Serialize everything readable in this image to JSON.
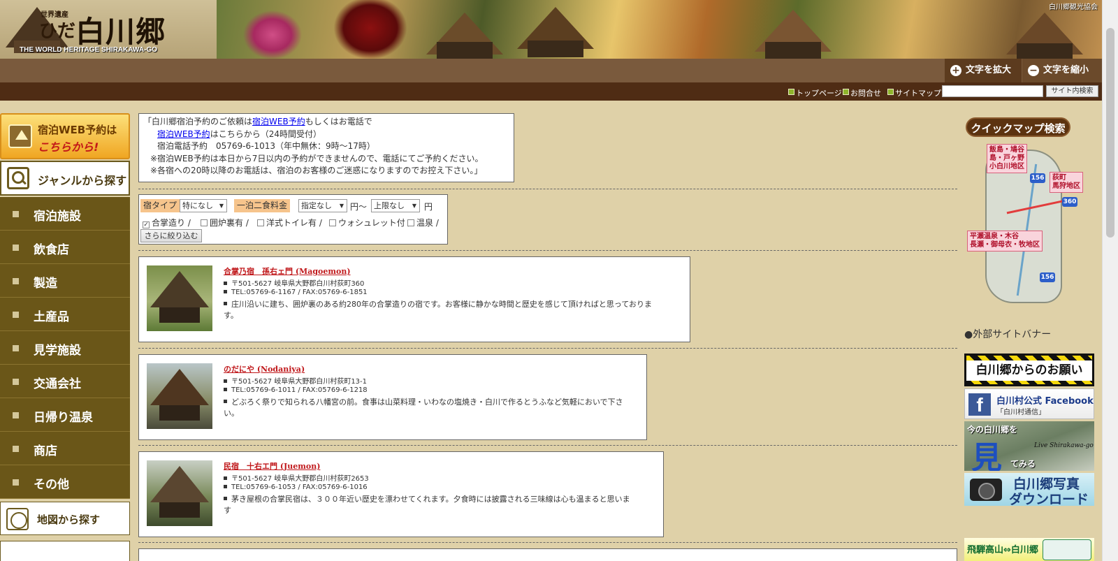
{
  "header": {
    "logo": {
      "heritage_label": "世界遺産",
      "hida_label": "ひだ",
      "name": "白川郷",
      "subtitle": "THE WORLD HERITAGE SHIRAKAWA-GO"
    },
    "association": "白川郷観光協会"
  },
  "font_controls": {
    "enlarge_label": "文字を拡大",
    "shrink_label": "文字を縮小"
  },
  "utility_nav": {
    "links": [
      "トップページ",
      "お問合せ",
      "サイトマップ"
    ],
    "search_placeholder": "",
    "search_button": "サイト内検索"
  },
  "sidebar": {
    "web_reserve": {
      "line1": "宿泊WEB予約は",
      "line2": "こちらから!"
    },
    "genre_heading": "ジャンルから探す",
    "genres": [
      "宿泊施設",
      "飲食店",
      "製造",
      "土産品",
      "見学施設",
      "交通会社",
      "日帰り温泉",
      "商店",
      "その他"
    ],
    "map_heading": "地図から探す"
  },
  "notice": {
    "line1_prefix": "「白川郷宿泊予約のご依頼は",
    "line1_link": "宿泊WEB予約",
    "line1_suffix": "もしくはお電話で",
    "line2_link": "宿泊WEB予約",
    "line2_suffix": "はこちらから（24時間受付）",
    "line3": "宿泊電話予約　05769-6-1013（年中無休：9時〜17時）",
    "line4": "※宿泊WEB予約は本日から7日以内の予約ができませんので、電話にてご予約ください。",
    "line5": "※各宿への20時以降のお電話は、宿泊のお客様のご迷惑になりますのでお控え下さい。」"
  },
  "filter": {
    "type_label": "宿タイプ",
    "type_value": "特になし",
    "price_label": "一泊二食料金",
    "price_min_value": "指定なし",
    "yen_from": "円〜",
    "price_max_value": "上限なし",
    "yen": "円",
    "checkboxes": [
      {
        "label": "合掌造り /",
        "checked": true
      },
      {
        "label": "囲炉裏有 /",
        "checked": false
      },
      {
        "label": "洋式トイレ有 /",
        "checked": false
      },
      {
        "label": "ウォシュレット付 /",
        "checked": false
      },
      {
        "label": "温泉 /",
        "checked": false
      }
    ],
    "submit_label": "さらに絞り込む"
  },
  "listings": [
    {
      "name": "合掌乃宿　孫右ェ門 (Magoemon)",
      "address": "〒501-5627 岐阜県大野郡白川村荻町360",
      "tel": "TEL:05769-6-1167 / FAX:05769-6-1851",
      "desc_line1": "庄川沿いに建ち、囲炉裏のある約280年の合掌造りの宿です。お客様に静かな時間と歴史を感じて頂ければと思っておりま",
      "desc_line2": "す。"
    },
    {
      "name": "のだにや (Nodaniya)",
      "address": "〒501-5627 岐阜県大野郡白川村荻町13-1",
      "tel": "TEL:05769-6-1011 / FAX:05769-6-1218",
      "desc_line1": "どぶろく祭りで知られる八幡宮の前。食事は山菜料理・いわなの塩焼き・白川で作るとうふなど気軽においで下さ",
      "desc_line2": "い。"
    },
    {
      "name": "民宿　十右エ門 (Juemon)",
      "address": "〒501-5627 岐阜県大野郡白川村荻町2653",
      "tel": "TEL:05769-6-1053 / FAX:05769-6-1016",
      "desc_line1": "茅き屋根の合掌民宿は、３００年近い歴史を漂わせてくれます。夕食時には披露される三味線は心も温まると思いま",
      "desc_line2": "す"
    }
  ],
  "right": {
    "quickmap_label": "クイックマップ検索",
    "regions": {
      "north": [
        "飯島・鳩谷",
        "島・戸ヶ野",
        "小白川地区"
      ],
      "east": [
        "荻町",
        "馬狩地区"
      ],
      "south": [
        "平瀬温泉・木谷",
        "長瀬・御母衣・牧地区"
      ]
    },
    "routes": [
      "156",
      "360",
      "156"
    ],
    "external_title": "●外部サイトバナー",
    "banners": {
      "request": "白川郷からのお願い",
      "facebook_title": "白川村公式 Facebook",
      "facebook_sub": "「白川村通信」",
      "live_line1": "今の白川郷を",
      "live_kanji": "見",
      "live_line2": "てみる",
      "live_tag": "Live Shirakawa-go",
      "photo_line1": "白川郷写真",
      "photo_line2": "ダウンロード",
      "bus": "飛騨高山⇔白川郷"
    }
  }
}
